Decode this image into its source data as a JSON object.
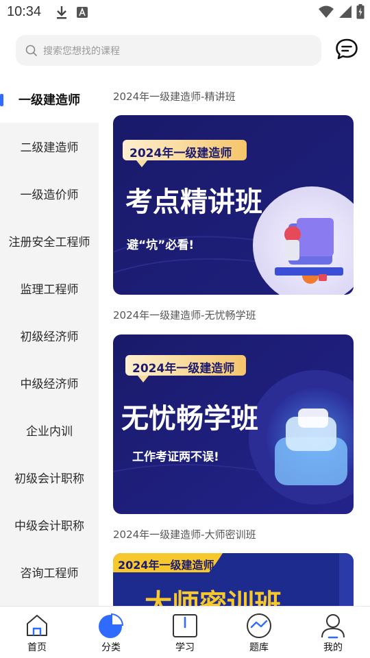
{
  "status_bar": {
    "time": "10:34"
  },
  "search": {
    "placeholder": "搜索您想找的课程"
  },
  "sidebar": {
    "items": [
      {
        "label": "一级建造师",
        "active": true
      },
      {
        "label": "二级建造师"
      },
      {
        "label": "一级造价师"
      },
      {
        "label": "注册安全工程师"
      },
      {
        "label": "监理工程师"
      },
      {
        "label": "初级经济师"
      },
      {
        "label": "中级经济师"
      },
      {
        "label": "企业内训"
      },
      {
        "label": "初级会计职称"
      },
      {
        "label": "中级会计职称"
      },
      {
        "label": "咨询工程师"
      }
    ]
  },
  "courses": [
    {
      "title": "2024年一级建造师-精讲班",
      "banner_tag": "2024年一级建造师",
      "banner_headline": "考点精讲班",
      "banner_sub": "避“坑”必看!"
    },
    {
      "title": "2024年一级建造师-无忧畅学班",
      "banner_tag": "2024年一级建造师",
      "banner_headline": "无忧畅学班",
      "banner_sub": "工作考证两不误!"
    },
    {
      "title": "2024年一级建造师-大师密训班",
      "banner_tag": "2024年一级建造师",
      "banner_headline": "大师密训班"
    }
  ],
  "tabbar": {
    "tabs": [
      {
        "label": "首页"
      },
      {
        "label": "分类",
        "active": true
      },
      {
        "label": "学习"
      },
      {
        "label": "题库"
      },
      {
        "label": "我的"
      }
    ]
  },
  "colors": {
    "accent": "#2f6bff",
    "banner_navy": "#1b1a6e",
    "tag_gold": "#f6c96b"
  }
}
